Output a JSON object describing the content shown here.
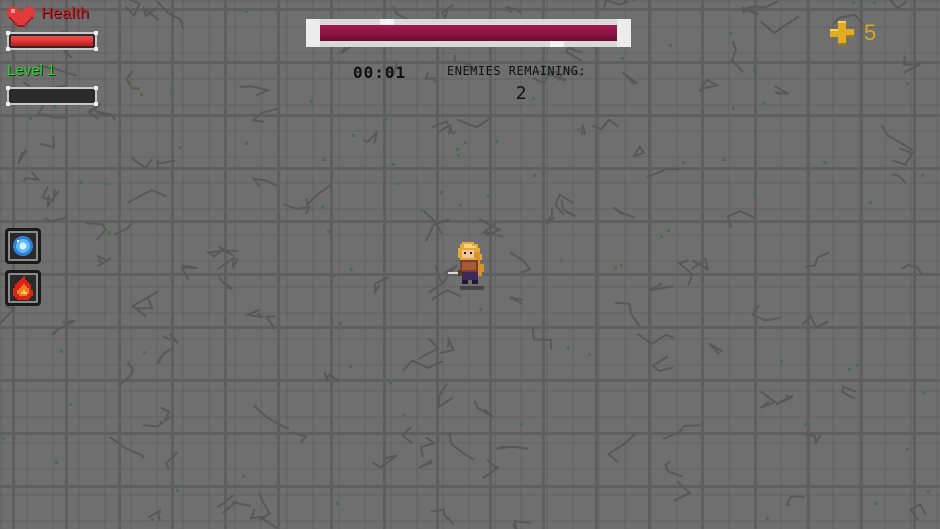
{
  "hud": {
    "health": {
      "label": "Health",
      "value_pct": 100,
      "color": "#e23a3a"
    },
    "level": {
      "label": "Level 1",
      "xp_pct": 0,
      "color": "#38c93a"
    }
  },
  "boss": {
    "health_pct": 100,
    "color": "#8b1242"
  },
  "timer": "00:01",
  "enemies": {
    "label": "ENEMIES REMAINING:",
    "count": "2"
  },
  "coins": {
    "count": "5",
    "icon": "coin-icon",
    "color": "#d8a920"
  },
  "abilities": [
    {
      "name": "ice-ability",
      "icon": "ice-orb-icon"
    },
    {
      "name": "fire-ability",
      "icon": "fireball-icon"
    }
  ]
}
